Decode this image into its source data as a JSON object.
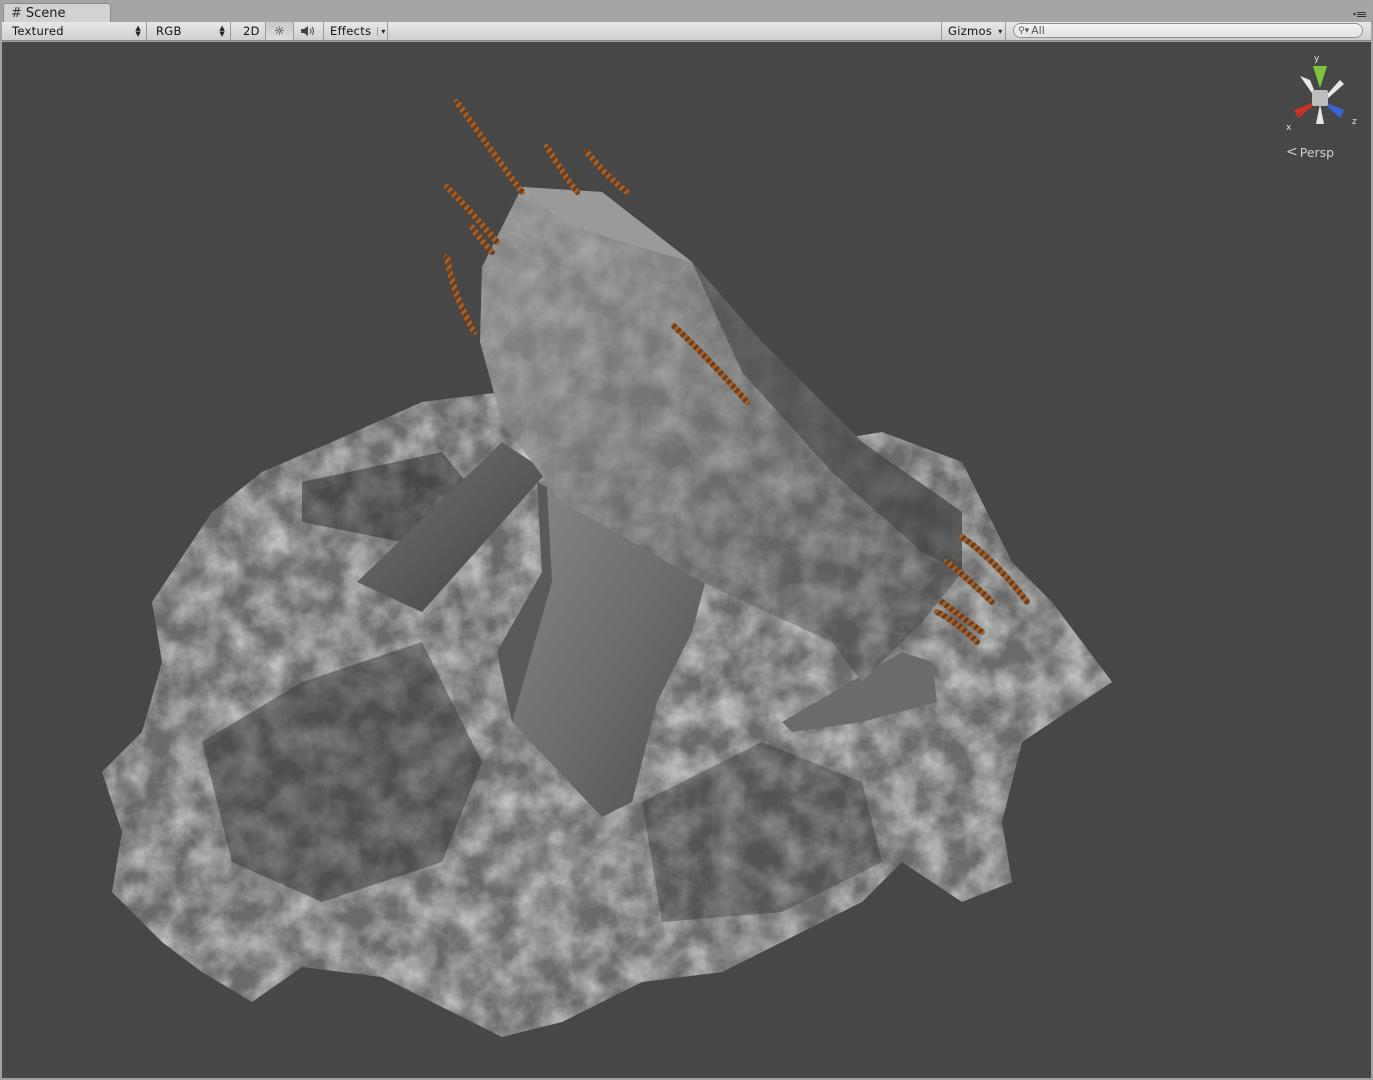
{
  "window": {
    "tab_label": "Scene",
    "tab_icon": "grid-icon"
  },
  "toolbar": {
    "draw_mode": "Textured",
    "render_mode": "RGB",
    "mode_2d": "2D",
    "lighting_icon": "sun-icon",
    "audio_icon": "speaker-icon",
    "effects_label": "Effects",
    "gizmos_label": "Gizmos",
    "search_value": "All"
  },
  "viewport": {
    "background": "#474747",
    "projection_label": "Persp",
    "axis_labels": {
      "x": "x",
      "y": "y",
      "z": "z"
    },
    "axis_colors": {
      "x": "#c8302a",
      "y": "#7fc63c",
      "z": "#3a63d8"
    }
  }
}
